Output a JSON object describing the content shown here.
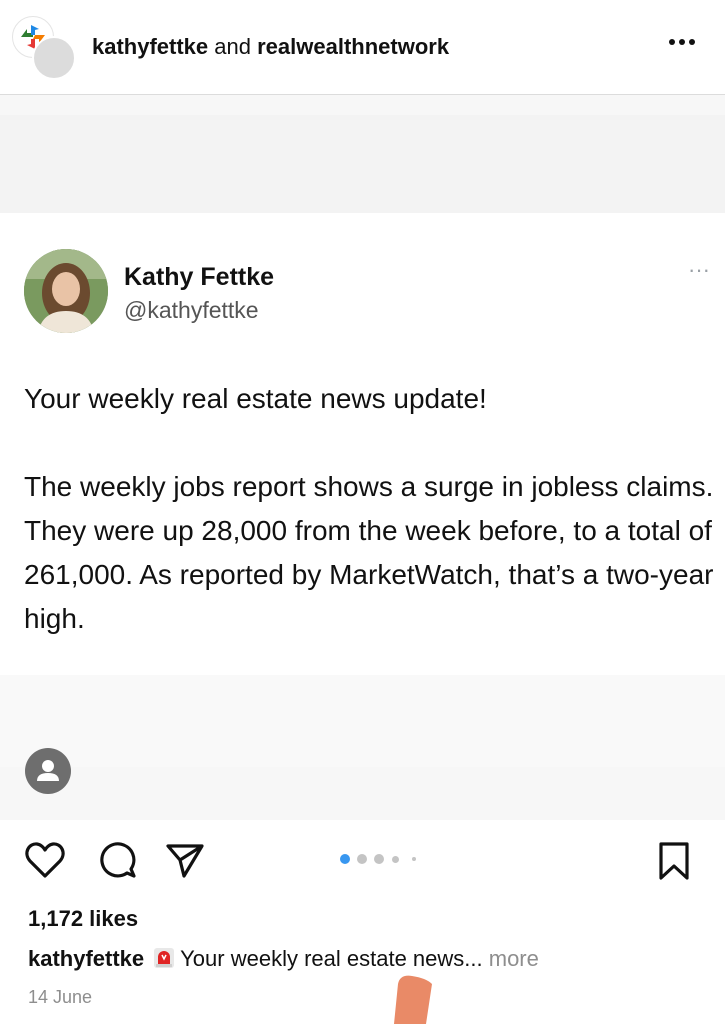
{
  "header": {
    "username_primary": "kathyfettke",
    "connector": "and",
    "username_secondary": "realwealthnetwork",
    "more_icon": "more-horizontal-icon"
  },
  "tweet": {
    "name": "Kathy Fettke",
    "handle": "@kathyfettke",
    "more": "···",
    "text": "Your weekly real estate news update!\n\nThe weekly jobs report shows a surge in jobless claims. They were up 28,000 from the week before, to a total of 261,000. As reported by MarketWatch, that’s a two-year high."
  },
  "actions": {
    "like_icon": "heart-icon",
    "comment_icon": "comment-icon",
    "share_icon": "send-icon",
    "save_icon": "bookmark-icon",
    "carousel_active_index": 0,
    "carousel_active_color": "#3897f0"
  },
  "likes": "1,172 likes",
  "caption": {
    "username": "kathyfettke",
    "emoji_icon": "siren-icon",
    "text": "Your weekly real estate news...",
    "more": "more"
  },
  "date": "14 June"
}
